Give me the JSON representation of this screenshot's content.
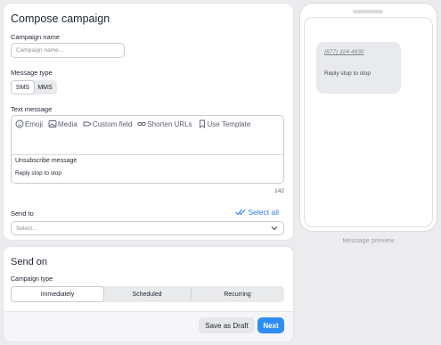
{
  "compose": {
    "title": "Compose campaign",
    "campaign_name_label": "Campaign name",
    "campaign_name_placeholder": "Campaign name...",
    "message_type_label": "Message type",
    "message_types": [
      "SMS",
      "MMS"
    ],
    "message_type_selected": "SMS",
    "text_message_label": "Text message",
    "toolbar": {
      "emoji": "Emoji",
      "media": "Media",
      "custom_field": "Custom field",
      "shorten_urls": "Shorten URLs",
      "use_template": "Use Template"
    },
    "unsubscribe_title": "Unsubscribe message",
    "unsubscribe_text": "Reply stop to stop",
    "char_count": "142",
    "send_to_label": "Send to",
    "select_all": "Select all",
    "send_to_placeholder": "Select..."
  },
  "send_on": {
    "title": "Send on",
    "campaign_type_label": "Campaign type",
    "campaign_types": [
      "Immediately",
      "Scheduled",
      "Recurring"
    ],
    "campaign_type_selected": "Immediately",
    "save_draft": "Save as Draft",
    "next": "Next"
  },
  "preview": {
    "phone_number": "(877) 324-4830",
    "message": "Reply stop to stop",
    "label": "Message preview"
  },
  "colors": {
    "accent": "#2e8ef5",
    "link": "#2c7be5"
  }
}
